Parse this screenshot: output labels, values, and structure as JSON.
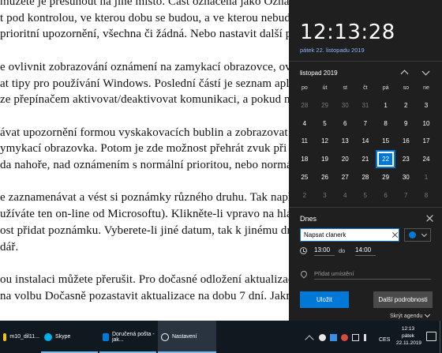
{
  "document": {
    "lines": [
      "můžete je přesunout na jiné místo. Část označená jako Oznámení, přepínačem určíte, zda má vůbec",
      "t pod kontrolou, ve kterou dobu se budou, a ve kterou nebudou zobrazovat, klikněte na odkaz Nastavení",
      "prioritní upozornění, všechna či žádná. Nebo nastavit další pravidla chov",
      "",
      "e ovlivnit zobrazování oznámení na zamykací obrazovce, ovlivnit chov",
      "at tipy pro používání Windows. Poslední částí je seznam aplikací, které",
      "ze přepínačem aktivovat/deaktivovat komunikaci, a pokud na ně klikne",
      "",
      "ávat upozornění formou vyskakovacích bublin a zobrazovat oznámení",
      "ymykací obrazovka. Potom je zde možnost přehrát zvuk při přejetí myši,",
      "da nahoře, nad oznámením s normální prioritou, nebo normální (výcho",
      "",
      "e zaznamenávat a vést si poznámky různého druhu. Tak například slouž",
      "užíváte ten on-line od Microsoftu). Klikněte-li vpravo na hlavní liště n",
      "ost přidat poznámku. Vyberete-li jiné datum, tak k jinému dni. Kromě t",
      "dář.",
      "",
      "ou instalaci můžete přerušit. Pro dočasné odložení aktualizací vašeho za",
      "na volbu Dočasně pozastavit aktualizace na dobu 7 dní. Jakmile bude do"
    ]
  },
  "flyout": {
    "time": "12:13:28",
    "date_link": "pátek 22. listopadu 2019",
    "month_label": "listopad 2019",
    "weekdays": [
      "po",
      "út",
      "st",
      "čt",
      "pá",
      "so",
      "ne"
    ],
    "days": [
      {
        "n": "28",
        "dim": true
      },
      {
        "n": "29",
        "dim": true
      },
      {
        "n": "30",
        "dim": true
      },
      {
        "n": "31",
        "dim": true
      },
      {
        "n": "1"
      },
      {
        "n": "2"
      },
      {
        "n": "3"
      },
      {
        "n": "4"
      },
      {
        "n": "5"
      },
      {
        "n": "6"
      },
      {
        "n": "7"
      },
      {
        "n": "8"
      },
      {
        "n": "9"
      },
      {
        "n": "10"
      },
      {
        "n": "11"
      },
      {
        "n": "12"
      },
      {
        "n": "13"
      },
      {
        "n": "14"
      },
      {
        "n": "15"
      },
      {
        "n": "16"
      },
      {
        "n": "17"
      },
      {
        "n": "18"
      },
      {
        "n": "19"
      },
      {
        "n": "20"
      },
      {
        "n": "21"
      },
      {
        "n": "22",
        "today": true
      },
      {
        "n": "23"
      },
      {
        "n": "24"
      },
      {
        "n": "25"
      },
      {
        "n": "26"
      },
      {
        "n": "27"
      },
      {
        "n": "28"
      },
      {
        "n": "29"
      },
      {
        "n": "30"
      },
      {
        "n": "1",
        "dim": true
      },
      {
        "n": "2",
        "dim": true
      },
      {
        "n": "3",
        "dim": true
      },
      {
        "n": "4",
        "dim": true
      },
      {
        "n": "5",
        "dim": true
      },
      {
        "n": "6",
        "dim": true
      },
      {
        "n": "7",
        "dim": true
      },
      {
        "n": "8",
        "dim": true
      }
    ],
    "event": {
      "header": "Dnes",
      "title_value": "Napsat clanerk",
      "color": "#0078d7",
      "start_time": "13:00",
      "time_separator": "do",
      "end_time": "14:00",
      "location_placeholder": "Přidat umístění",
      "save_label": "Uložit",
      "more_label": "Další podrobnosti",
      "agenda_label": "Skrýt agendu"
    }
  },
  "taskbar": {
    "tasks": [
      {
        "label": "m10_dil11...",
        "icon_color": "#f0c419",
        "icon": "folder-icon"
      },
      {
        "label": "Skype",
        "icon_color": "#00aff0",
        "icon": "skype-icon"
      },
      {
        "label": "Doručená pošta - jak...",
        "icon_color": "#0078d7",
        "icon": "mail-icon"
      },
      {
        "label": "Nastavení",
        "icon_color": "#ffffff",
        "icon": "gear-icon"
      }
    ],
    "language": "CES",
    "clock_time": "12:13",
    "clock_day": "pátek",
    "clock_date": "22.11.2019"
  }
}
